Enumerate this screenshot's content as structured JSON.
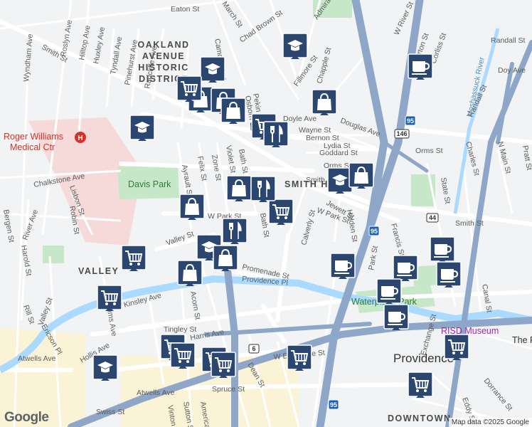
{
  "map": {
    "street_labels": [
      "Eaton St",
      "March St",
      "Chad Brown St",
      "Admiral St",
      "W River St",
      "Ashburton St",
      "Corliss St",
      "Roslyn Ave",
      "Hilltop Ave",
      "Huxley Ave",
      "Tyndall Ave",
      "Pinehurst Ave",
      "Radcliffe Ave",
      "Wyndham Ave",
      "Smith St",
      "Camden Ave",
      "Pekin St",
      "Osborn St",
      "Fillmore St",
      "Chapple St",
      "Douglas Ave",
      "Doyle Ave",
      "Wayne St",
      "Bernon St",
      "Lydia St",
      "Goddard St",
      "Orms St",
      "Randall St",
      "Charles St",
      "N Main St",
      "Pratt St",
      "Chalkstone Ave",
      "Lisbon St",
      "Felix St",
      "Ayrault St",
      "Zone St",
      "Violet St",
      "Bath St",
      "Calverly St",
      "Jewett St",
      "Holden St",
      "W Park St",
      "Smith St",
      "State St",
      "Francis St",
      "Park St",
      "Canal St",
      "River Ave",
      "Bergen St",
      "Robin St",
      "Harold St",
      "Valley St",
      "Promenade St",
      "Providence Pl",
      "Kinsley Ave",
      "Acorn St",
      "Tingley St",
      "Harris Ave",
      "W Exchange St",
      "Sims Ave",
      "Rill St",
      "Valley St",
      "Ericson Pl",
      "Atwells Ave",
      "Hollis Ave",
      "Dean St",
      "Spruce St",
      "Atwells Ave",
      "Swiss St",
      "Vinton St",
      "Sutton St",
      "America St",
      "Eddy St",
      "Dorrance St",
      "Exchange St",
      "Orms St",
      "Smith St",
      "Bath St",
      "W Park St",
      "Doy Ave",
      "Randall St"
    ],
    "district_labels": [
      "OAKLAND",
      "AVENUE",
      "HISTORIC",
      "DISTRICT",
      "SMITH HILL",
      "VALLEY",
      "DOWNTOWN",
      "PROVIDENCE"
    ],
    "poi_labels": [
      "Roger Williams",
      "Medical Ctr",
      "Davis Park",
      "Waterplace Park",
      "RISD Museum",
      "Providence",
      "Moshassuck River",
      "The R"
    ],
    "highway_shields": [
      "44",
      "44",
      "146",
      "95",
      "95",
      "6",
      "95",
      "44"
    ],
    "markers": [
      {
        "type": "school",
        "icon": "graduation-cap-icon"
      },
      {
        "type": "school",
        "icon": "graduation-cap-icon"
      },
      {
        "type": "school",
        "icon": "graduation-cap-icon"
      },
      {
        "type": "school",
        "icon": "graduation-cap-icon"
      },
      {
        "type": "school",
        "icon": "graduation-cap-icon"
      },
      {
        "type": "school",
        "icon": "graduation-cap-icon"
      },
      {
        "type": "shopping",
        "icon": "shopping-bag-icon"
      },
      {
        "type": "shopping",
        "icon": "shopping-bag-icon"
      },
      {
        "type": "shopping",
        "icon": "shopping-bag-icon"
      },
      {
        "type": "shopping",
        "icon": "shopping-bag-icon"
      },
      {
        "type": "shopping",
        "icon": "shopping-bag-icon"
      },
      {
        "type": "shopping",
        "icon": "shopping-bag-icon"
      },
      {
        "type": "shopping",
        "icon": "shopping-bag-icon"
      },
      {
        "type": "shopping",
        "icon": "shopping-bag-icon"
      },
      {
        "type": "grocery",
        "icon": "shopping-cart-icon"
      },
      {
        "type": "grocery",
        "icon": "shopping-cart-icon"
      },
      {
        "type": "grocery",
        "icon": "shopping-cart-icon"
      },
      {
        "type": "grocery",
        "icon": "shopping-cart-icon"
      },
      {
        "type": "grocery",
        "icon": "shopping-cart-icon"
      },
      {
        "type": "grocery",
        "icon": "shopping-cart-icon"
      },
      {
        "type": "grocery",
        "icon": "shopping-cart-icon"
      },
      {
        "type": "grocery",
        "icon": "shopping-cart-icon"
      },
      {
        "type": "grocery",
        "icon": "shopping-cart-icon"
      },
      {
        "type": "grocery",
        "icon": "shopping-cart-icon"
      },
      {
        "type": "restaurant",
        "icon": "fork-knife-icon"
      },
      {
        "type": "restaurant",
        "icon": "fork-knife-icon"
      },
      {
        "type": "restaurant",
        "icon": "fork-knife-icon"
      },
      {
        "type": "cafe",
        "icon": "coffee-cup-icon"
      },
      {
        "type": "cafe",
        "icon": "coffee-cup-icon"
      },
      {
        "type": "cafe",
        "icon": "coffee-cup-icon"
      },
      {
        "type": "cafe",
        "icon": "coffee-cup-icon"
      },
      {
        "type": "cafe",
        "icon": "coffee-cup-icon"
      },
      {
        "type": "cafe",
        "icon": "coffee-cup-icon"
      },
      {
        "type": "cafe",
        "icon": "coffee-cup-icon"
      },
      {
        "type": "cafe",
        "icon": "coffee-cup-icon"
      }
    ],
    "colors": {
      "background": "#f1f3f4",
      "highway": "#8ea6c7",
      "major_road": "#ffffff",
      "river": "#aadaff",
      "park": "#c6e8c9",
      "hospital": "#f6dada",
      "marker": "#2b4770"
    }
  },
  "footer": {
    "attribution": "Map data ©2025 Google",
    "logo": "Google"
  }
}
